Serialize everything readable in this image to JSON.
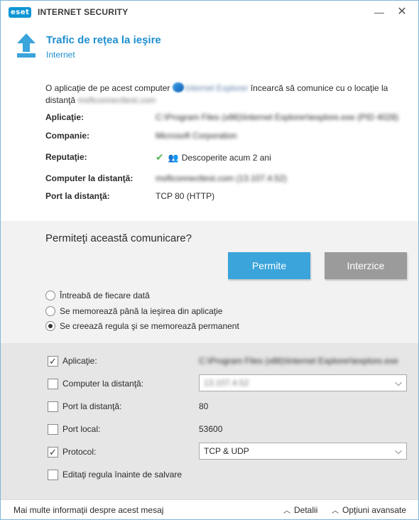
{
  "titlebar": {
    "logo": "eset",
    "product": "INTERNET SECURITY",
    "minimize": "—",
    "close": "✕"
  },
  "header": {
    "icon": "upload-arrow-icon",
    "title": "Trafic de reţea la ieşire",
    "subtitle": "Internet"
  },
  "intro": {
    "prefix": "O aplicaţie de pe acest computer",
    "app_name": "Internet Explorer",
    "middle": "încearcă să comunice cu o locaţie la distanţă",
    "remote": "msftconnecttest.com"
  },
  "details": [
    {
      "label": "Aplicaţie:",
      "value": "C:\\Program Files (x86)\\Internet Explorer\\iexplore.exe (PID 4028)"
    },
    {
      "label": "Companie:",
      "value": "Microsoft Corporation"
    },
    {
      "label": "Reputaţie:",
      "value": "Descoperite acum 2 ani"
    },
    {
      "label": "Computer la distanţă:",
      "value": "msftconnecttest.com (13.107.4.52)"
    },
    {
      "label": "Port la distanţă:",
      "value": "TCP 80 (HTTP)"
    }
  ],
  "question": {
    "text": "Permiteţi această comunicare?",
    "allow": "Permite",
    "deny": "Interzice"
  },
  "radios": [
    {
      "label": "Întreabă de fiecare dată",
      "checked": false
    },
    {
      "label": "Se memorează până la ieşirea din aplicaţie",
      "checked": false
    },
    {
      "label": "Se creează regula şi se memorează permanent",
      "checked": true
    }
  ],
  "options": {
    "application": {
      "label": "Aplicaţie:",
      "value": "C:\\Program Files (x86)\\Internet Explorer\\iexplore.exe",
      "checked": true
    },
    "remote_computer": {
      "label": "Computer la distanţă:",
      "value": "13.107.4.52",
      "checked": false
    },
    "remote_port": {
      "label": "Port la distanţă:",
      "value": "80",
      "checked": false
    },
    "local_port": {
      "label": "Port local:",
      "value": "53600",
      "checked": false
    },
    "protocol": {
      "label": "Protocol:",
      "value": "TCP & UDP",
      "checked": true
    },
    "edit_rule": {
      "label": "Editaţi regula înainte de salvare",
      "checked": false
    }
  },
  "footer": {
    "more_info": "Mai multe informaţii despre acest mesaj",
    "details": "Detalii",
    "advanced": "Opţiuni avansate"
  },
  "colors": {
    "accent": "#1f8fd0",
    "allow_button": "#3aa4db",
    "deny_button": "#9b9b9b"
  }
}
